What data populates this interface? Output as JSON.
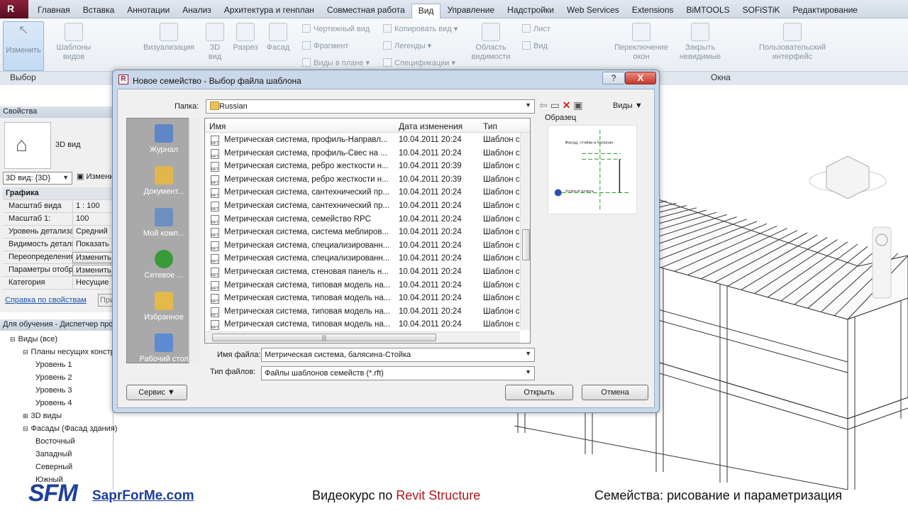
{
  "ribbon": {
    "tabs": [
      "Главная",
      "Вставка",
      "Аннотации",
      "Анализ",
      "Архитектура и генплан",
      "Совместная работа",
      "Вид",
      "Управление",
      "Надстройки",
      "Web Services",
      "Extensions",
      "BiMTOOLS",
      "SOFiSTiK",
      "Редактирование"
    ],
    "active_tab": "Вид",
    "buttons": {
      "modify": "Изменить",
      "view_templates": "Шаблоны видов",
      "visualization": "Визуализация",
      "view_3d": "3D вид",
      "section": "Разрез",
      "elevation": "Фасад",
      "drafting_view": "Чертежный вид",
      "copy_view": "Копировать вид",
      "fragment": "Фрагмент",
      "legends": "Легенды",
      "plan_views": "Виды в плане",
      "schedules": "Спецификации",
      "scope_box": "Область видимости",
      "sheet": "Лист",
      "view": "Вид",
      "switch_windows": "Переключение окон",
      "close_hidden": "Закрыть невидимые",
      "user_interface": "Пользовательский интерфейс"
    },
    "groups": {
      "select": "Выбор",
      "windows": "Окна"
    }
  },
  "properties": {
    "title": "Свойства",
    "type_name": "3D вид",
    "view_selector": "3D вид: {3D}",
    "edit_type": "Изменить тип",
    "section_graphics": "Графика",
    "rows": [
      {
        "k": "Масштаб вида",
        "v": "1 : 100"
      },
      {
        "k": "Масштаб 1:",
        "v": "100"
      },
      {
        "k": "Уровень детализации",
        "v": "Средний"
      },
      {
        "k": "Видимость детали",
        "v": "Показать"
      },
      {
        "k": "Переопределения",
        "v": "Изменить..."
      },
      {
        "k": "Параметры отображения",
        "v": "Изменить..."
      },
      {
        "k": "Категория",
        "v": "Несущие"
      }
    ],
    "help_link": "Справка по свойствам",
    "apply": "Применить"
  },
  "browser": {
    "title": "Для обучения - Диспетчер проекта",
    "nodes": [
      {
        "label": "Виды (все)",
        "level": 0
      },
      {
        "label": "Планы несущих конструкций",
        "level": 1
      },
      {
        "label": "Уровень 1",
        "level": 2
      },
      {
        "label": "Уровень 2",
        "level": 2
      },
      {
        "label": "Уровень 3",
        "level": 2
      },
      {
        "label": "Уровень 4",
        "level": 2
      },
      {
        "label": "3D виды",
        "level": 1
      },
      {
        "label": "Фасады (Фасад здания)",
        "level": 1
      },
      {
        "label": "Восточный",
        "level": 2
      },
      {
        "label": "Западный",
        "level": 2
      },
      {
        "label": "Северный",
        "level": 2
      },
      {
        "label": "Южный",
        "level": 2
      }
    ]
  },
  "dialog": {
    "title": "Новое семейство - Выбор файла шаблона",
    "help": "?",
    "close": "X",
    "folder_label": "Папка:",
    "folder": "Russian",
    "views_btn": "Виды",
    "preview_label": "Образец",
    "preview_caption": "Фасад, стойки и балясин",
    "preview_level": "Опорный уровень",
    "places": [
      "Журнал",
      "Документ...",
      "Мой комп...",
      "Сетевое ...",
      "Избранное",
      "Рабочий стол"
    ],
    "columns": {
      "name": "Имя",
      "date": "Дата изменения",
      "type": "Тип"
    },
    "files": [
      {
        "name": "Метрическая система, профиль-Направл...",
        "date": "10.04.2011 20:24",
        "type": "Шаблон се"
      },
      {
        "name": "Метрическая система, профиль-Свес на ...",
        "date": "10.04.2011 20:24",
        "type": "Шаблон се"
      },
      {
        "name": "Метрическая система, ребро жесткости н...",
        "date": "10.04.2011 20:39",
        "type": "Шаблон се"
      },
      {
        "name": "Метрическая система, ребро жесткости н...",
        "date": "10.04.2011 20:39",
        "type": "Шаблон се"
      },
      {
        "name": "Метрическая система, сантехнический пр...",
        "date": "10.04.2011 20:24",
        "type": "Шаблон се"
      },
      {
        "name": "Метрическая система, сантехнический пр...",
        "date": "10.04.2011 20:24",
        "type": "Шаблон се"
      },
      {
        "name": "Метрическая система, семейство RPC",
        "date": "10.04.2011 20:24",
        "type": "Шаблон се"
      },
      {
        "name": "Метрическая система, система меблиров...",
        "date": "10.04.2011 20:24",
        "type": "Шаблон се"
      },
      {
        "name": "Метрическая система, специализированн...",
        "date": "10.04.2011 20:24",
        "type": "Шаблон се"
      },
      {
        "name": "Метрическая система, специализированн...",
        "date": "10.04.2011 20:24",
        "type": "Шаблон се"
      },
      {
        "name": "Метрическая система, стеновая панель н...",
        "date": "10.04.2011 20:24",
        "type": "Шаблон се"
      },
      {
        "name": "Метрическая система, типовая модель на...",
        "date": "10.04.2011 20:24",
        "type": "Шаблон се"
      },
      {
        "name": "Метрическая система, типовая модель на...",
        "date": "10.04.2011 20:24",
        "type": "Шаблон се"
      },
      {
        "name": "Метрическая система, типовая модель на...",
        "date": "10.04.2011 20:24",
        "type": "Шаблон се"
      },
      {
        "name": "Метрическая система, типовая модель на...",
        "date": "10.04.2011 20:24",
        "type": "Шаблон се"
      }
    ],
    "filename_label": "Имя файла:",
    "filename": "Метрическая система, балясина-Стойка",
    "filetype_label": "Тип файлов:",
    "filetype": "Файлы шаблонов семейств (*.rft)",
    "service": "Сервис",
    "open": "Открыть",
    "cancel": "Отмена"
  },
  "banner": {
    "logo": "SFM",
    "site": "SaprForMe.com",
    "course_prefix": "Видеокурс по ",
    "course_accent": "Revit Structure",
    "topic": "Семейства: рисование и параметризация"
  },
  "colors": {
    "accent": "#b0161c",
    "brand": "#1e3f9a"
  }
}
